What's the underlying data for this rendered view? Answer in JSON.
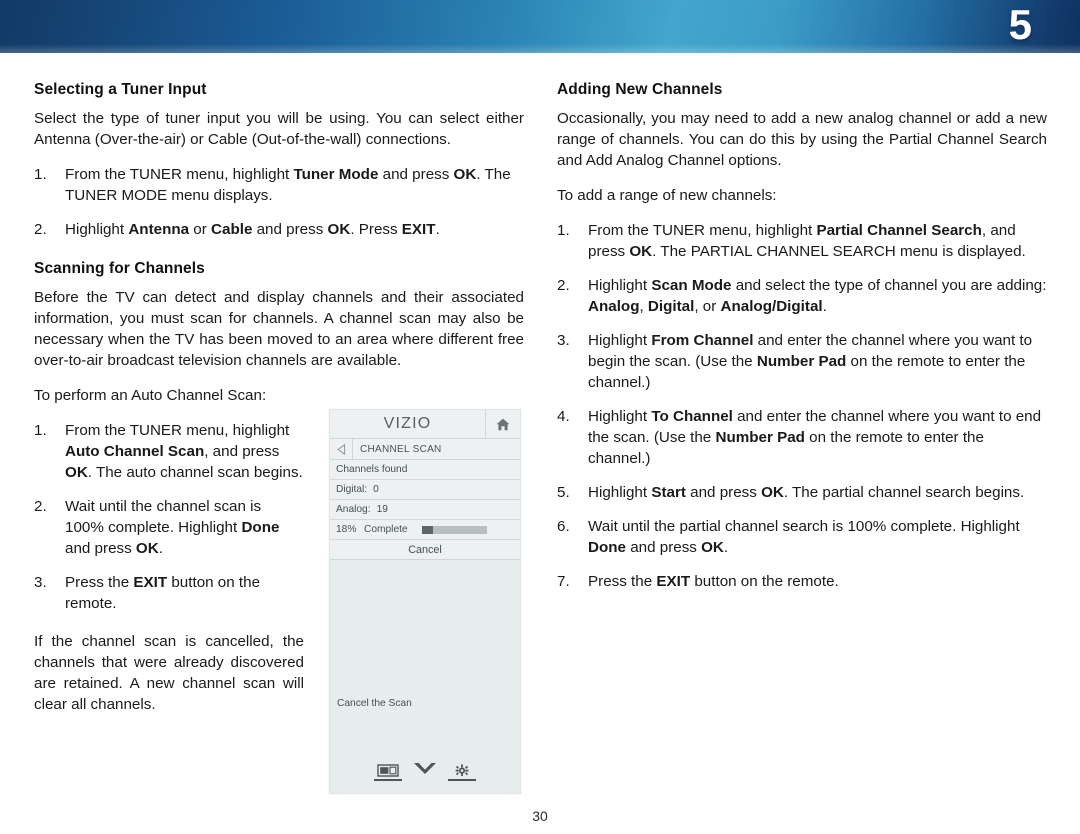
{
  "banner": {
    "chapter_number": "5",
    "gradient_dark": "#123a66",
    "gradient_light": "#44a6cc"
  },
  "left_column": {
    "section1": {
      "heading": "Selecting a Tuner Input",
      "intro": "Select the type of tuner input you will be using. You can select either Antenna (Over-the-air) or Cable (Out-of-the-wall) connections.",
      "steps": [
        {
          "marker": "1.",
          "html": "From the TUNER menu, highlight <b>Tuner Mode</b> and press <b>OK</b>. The TUNER MODE menu displays."
        },
        {
          "marker": "2.",
          "html": "Highlight <b>Antenna</b> or <b>Cable</b> and press <b>OK</b>. Press <b>EXIT</b>."
        }
      ]
    },
    "section2": {
      "heading": "Scanning for Channels",
      "intro": "Before the TV can detect and display channels and their associated information, you must scan for channels. A channel scan may also be necessary when the TV has been moved to an area where different free over-to-air broadcast television channels are available.",
      "lead_in": "To perform an Auto Channel Scan:",
      "steps": [
        {
          "marker": "1.",
          "html": "From the TUNER menu, highlight <b>Auto Channel Scan</b>, and press <b>OK</b>. The auto channel scan begins."
        },
        {
          "marker": "2.",
          "html": "Wait until the channel scan is 100% complete. Highlight <b>Done</b> and press <b>OK</b>."
        },
        {
          "marker": "3.",
          "html": "Press the <b>EXIT</b> button on the remote."
        }
      ],
      "closing": "If the channel scan is cancelled, the channels that were already discovered are retained. A new channel scan will clear all channels."
    }
  },
  "right_column": {
    "section1": {
      "heading": "Adding New Channels",
      "intro": "Occasionally, you may need to add a new analog channel or add a new range of channels. You can do this by using the Partial Channel Search and Add Analog Channel options.",
      "lead_in": "To add a range of new channels:",
      "steps": [
        {
          "marker": "1.",
          "html": "From the TUNER menu, highlight <b>Partial Channel Search</b>, and press <b>OK</b>. The PARTIAL CHANNEL SEARCH menu is displayed."
        },
        {
          "marker": "2.",
          "html": "Highlight <b>Scan Mode</b> and select the type of channel you are adding: <b>Analog</b>, <b>Digital</b>, or <b>Analog/Digital</b>."
        },
        {
          "marker": "3.",
          "html": "Highlight <b>From Channel</b> and enter the channel where you want to begin the scan. (Use the <b>Number Pad</b> on the remote to enter the channel.)"
        },
        {
          "marker": "4.",
          "html": "Highlight <b>To Channel</b> and enter the channel where you want to end the scan. (Use the <b>Number Pad</b> on the remote to enter the channel.)"
        },
        {
          "marker": "5.",
          "html": "Highlight <b>Start</b> and press <b>OK</b>. The partial channel search begins."
        },
        {
          "marker": "6.",
          "html": "Wait until the partial channel search is 100% complete. Highlight <b>Done</b> and press <b>OK</b>."
        },
        {
          "marker": "7.",
          "html": "Press the <b>EXIT</b> button on the remote."
        }
      ]
    }
  },
  "osd": {
    "brand": "VIZIO",
    "home_icon": "home-icon",
    "back_icon": "back-arrow-icon",
    "breadcrumb": "CHANNEL SCAN",
    "rows": [
      {
        "label": "Channels found",
        "value": ""
      },
      {
        "label": "Digital:",
        "value": "0"
      },
      {
        "label": "Analog:",
        "value": "19"
      }
    ],
    "progress": {
      "percent_label": "18%",
      "status_label": "Complete",
      "percent_value": 18
    },
    "cancel_label": "Cancel",
    "hint": "Cancel the Scan",
    "footer_icons": [
      "picture-icon",
      "chevron-down-icon",
      "gear-icon"
    ]
  },
  "footer": {
    "page_number": "30"
  }
}
